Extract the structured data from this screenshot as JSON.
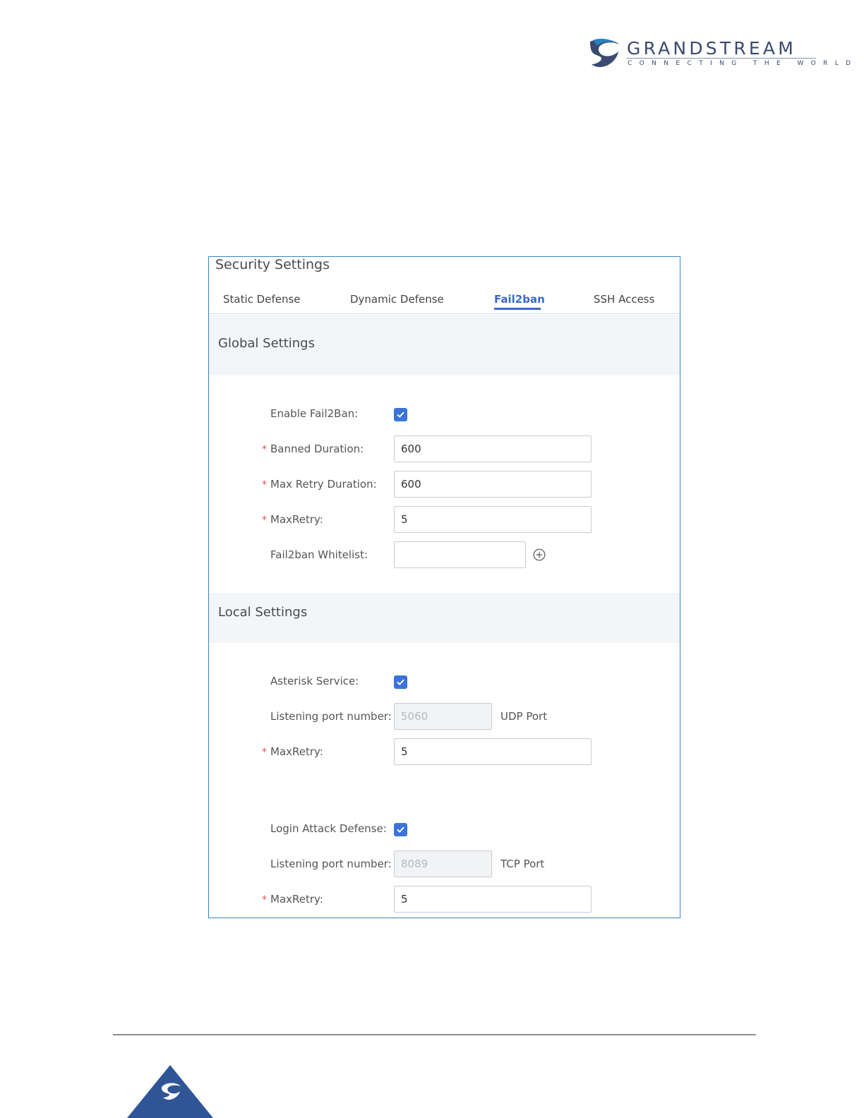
{
  "brand": {
    "name": "GRANDSTREAM",
    "tagline": "CONNECTING THE WORLD",
    "colors": {
      "primary": "#3a4a70",
      "accent": "#3b68c9"
    }
  },
  "page": {
    "title": "Security Settings"
  },
  "tabs": [
    {
      "label": "Static Defense",
      "active": false
    },
    {
      "label": "Dynamic Defense",
      "active": false
    },
    {
      "label": "Fail2ban",
      "active": true
    },
    {
      "label": "SSH Access",
      "active": false
    }
  ],
  "global_settings": {
    "heading": "Global Settings",
    "enable_fail2ban": {
      "label": "Enable Fail2Ban:",
      "checked": true
    },
    "banned_duration": {
      "label": "Banned Duration:",
      "required": true,
      "value": "600"
    },
    "max_retry_duration": {
      "label": "Max Retry Duration:",
      "required": true,
      "value": "600"
    },
    "max_retry": {
      "label": "MaxRetry:",
      "required": true,
      "value": "5"
    },
    "whitelist": {
      "label": "Fail2ban Whitelist:",
      "value": "",
      "add_icon": "plus-circle-icon"
    }
  },
  "local_settings": {
    "heading": "Local Settings",
    "asterisk_service": {
      "label": "Asterisk Service:",
      "checked": true
    },
    "asterisk_port": {
      "label": "Listening port number:",
      "value": "5060",
      "unit": "UDP Port",
      "disabled": true
    },
    "asterisk_max_retry": {
      "label": "MaxRetry:",
      "required": true,
      "value": "5"
    },
    "login_attack_defense": {
      "label": "Login Attack Defense:",
      "checked": true
    },
    "login_port": {
      "label": "Listening port number:",
      "value": "8089",
      "unit": "TCP Port",
      "disabled": true
    },
    "login_max_retry": {
      "label": "MaxRetry:",
      "required": true,
      "value": "5"
    }
  },
  "required_marker": "*"
}
